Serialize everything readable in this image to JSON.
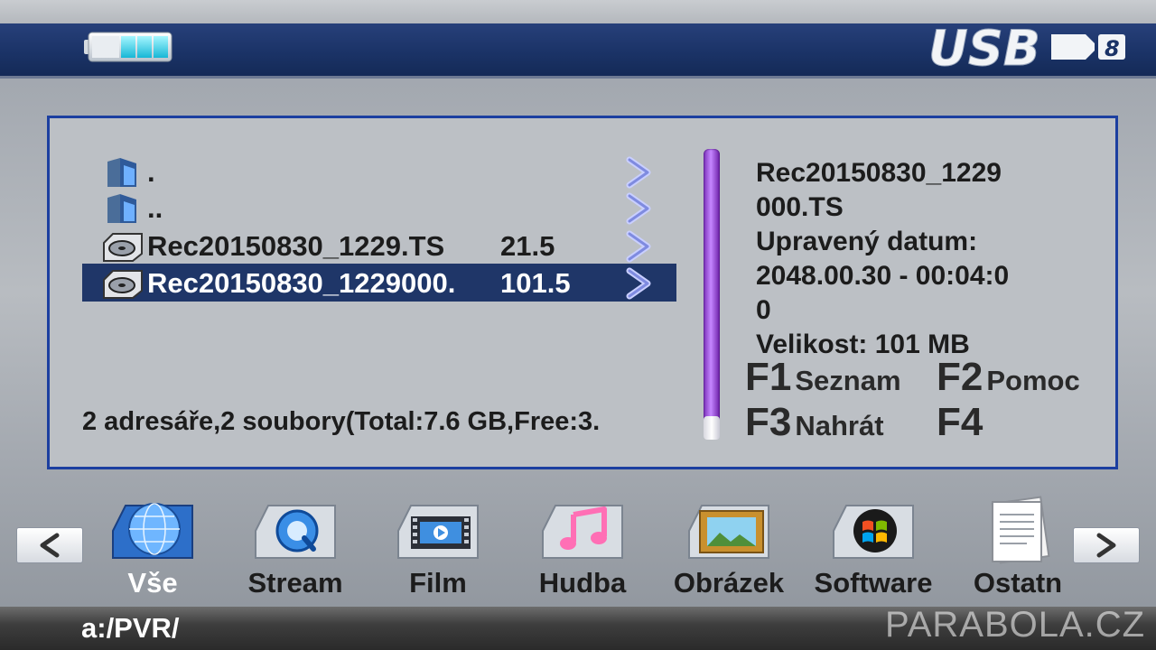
{
  "header": {
    "battery_icon": "battery-icon",
    "usb_logo_text": "USB",
    "usb_logo_suffix": "8"
  },
  "file_list": {
    "rows": [
      {
        "name": ".",
        "size": "",
        "icon": "folder-icon",
        "selected": false
      },
      {
        "name": "..",
        "size": "",
        "icon": "folder-icon",
        "selected": false
      },
      {
        "name": "Rec20150830_1229.TS",
        "size": "21.5",
        "icon": "hdd-record-icon",
        "selected": false
      },
      {
        "name": "Rec20150830_1229000.",
        "size": "101.5",
        "icon": "hdd-record-icon",
        "selected": true
      }
    ],
    "summary": "2 adresáře,2 soubory(Total:7.6 GB,Free:3."
  },
  "info": {
    "line1": "Rec20150830_1229",
    "line2": "000.TS",
    "line3": "Upravený datum:",
    "line4": "2048.00.30 - 00:04:0",
    "line5": "0",
    "line6": "Velikost: 101 MB"
  },
  "function_keys": {
    "f1": {
      "key": "F1",
      "label": "Seznam"
    },
    "f2": {
      "key": "F2",
      "label": "Pomoc"
    },
    "f3": {
      "key": "F3",
      "label": "Nahrát"
    },
    "f4": {
      "key": "F4",
      "label": ""
    }
  },
  "categories": [
    {
      "label": "Vše",
      "icon": "globe-icon",
      "active": true
    },
    {
      "label": "Stream",
      "icon": "quicktime-icon",
      "active": false
    },
    {
      "label": "Film",
      "icon": "film-icon",
      "active": false
    },
    {
      "label": "Hudba",
      "icon": "music-note-icon",
      "active": false
    },
    {
      "label": "Obrázek",
      "icon": "picture-icon",
      "active": false
    },
    {
      "label": "Software",
      "icon": "windows-icon",
      "active": false
    },
    {
      "label": "Ostatn",
      "icon": "document-icon",
      "active": false
    }
  ],
  "status": {
    "path": "a:/PVR/",
    "watermark": "PARABOLA.CZ"
  },
  "colors": {
    "header_blue": "#1b3367",
    "selected_row": "#1f3668",
    "panel_border": "#1c3fa0",
    "scrollbar": "#8a3fd0"
  }
}
